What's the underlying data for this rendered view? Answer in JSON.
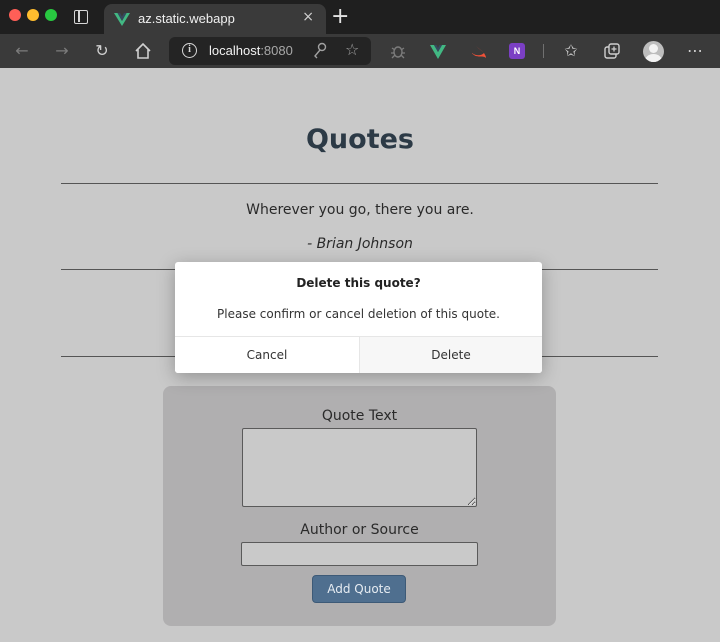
{
  "browser": {
    "tab_title": "az.static.webapp",
    "tab_close": "×",
    "new_tab": "+",
    "url_host": "localhost",
    "url_port": ":8080",
    "icons": [
      "back-icon",
      "forward-icon",
      "reload-icon",
      "home-icon",
      "info-icon",
      "key-icon",
      "add-favorite-icon",
      "extension-bug-icon",
      "extension-vue-icon",
      "extension-swift-icon",
      "extension-onenote-icon",
      "favorites-icon",
      "collections-icon",
      "profile-icon",
      "more-icon"
    ],
    "onenote_label": "N"
  },
  "page": {
    "title": "Quotes",
    "quote": {
      "text": "Wherever you go, there you are.",
      "author": "- Brian Johnson"
    },
    "form": {
      "quote_label": "Quote Text",
      "quote_value": "",
      "author_label": "Author or Source",
      "author_value": "",
      "submit_label": "Add Quote"
    }
  },
  "dialog": {
    "title": "Delete this quote?",
    "message": "Please confirm or cancel deletion of this quote.",
    "cancel_label": "Cancel",
    "delete_label": "Delete"
  },
  "colors": {
    "page_background": "#c9c9c9",
    "title_color": "#2c3a46",
    "button_primary": "#4f6f8f",
    "vue_green": "#42b883",
    "onenote_purple": "#7b3fc4"
  }
}
